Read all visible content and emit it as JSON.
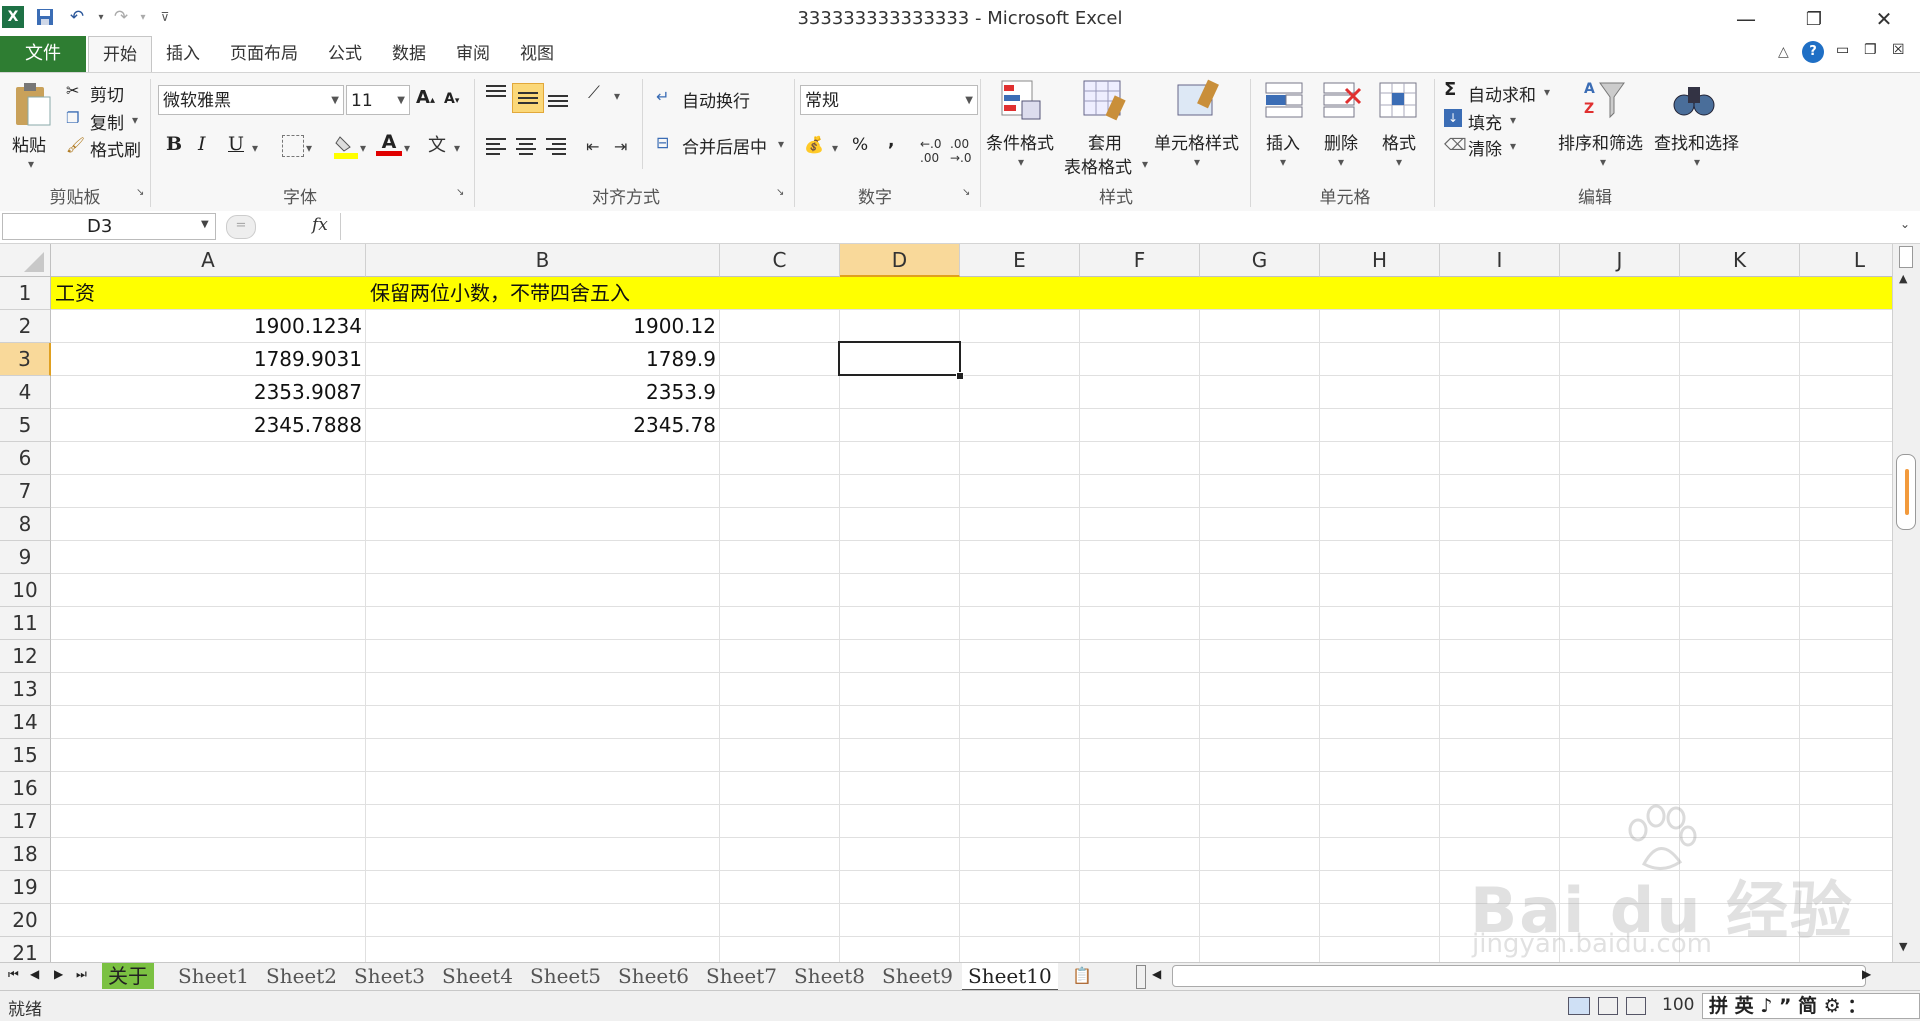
{
  "window": {
    "title": "333333333333333 - Microsoft Excel",
    "minimize_icon": "minimize-icon",
    "restore_icon": "restore-icon",
    "close_icon": "close-icon"
  },
  "tabs": [
    "文件",
    "开始",
    "插入",
    "页面布局",
    "公式",
    "数据",
    "审阅",
    "视图"
  ],
  "ribbon": {
    "clipboard": {
      "paste": "粘贴",
      "cut": "剪切",
      "copy": "复制",
      "format_painter": "格式刷",
      "label": "剪贴板"
    },
    "font": {
      "name": "微软雅黑",
      "size": "11",
      "label": "字体",
      "bold": "B",
      "italic": "I",
      "underline": "U"
    },
    "alignment": {
      "wrap": "自动换行",
      "merge": "合并后居中",
      "label": "对齐方式"
    },
    "number": {
      "format": "常规",
      "percent": "%",
      "comma": ",",
      "label": "数字"
    },
    "styles": {
      "conditional": "条件格式",
      "table_line1": "套用",
      "table_line2": "表格格式",
      "cell_styles": "单元格样式",
      "label": "样式"
    },
    "cells": {
      "insert": "插入",
      "delete": "删除",
      "format": "格式",
      "label": "单元格"
    },
    "editing": {
      "autosum": "自动求和",
      "fill": "填充",
      "clear": "清除",
      "sort": "排序和筛选",
      "find": "查找和选择",
      "label": "编辑"
    }
  },
  "formula_bar": {
    "name_box": "D3",
    "fx": "fx",
    "value": ""
  },
  "grid": {
    "columns": [
      "A",
      "B",
      "C",
      "D",
      "E",
      "F",
      "G",
      "H",
      "I",
      "J",
      "K",
      "L"
    ],
    "selected_column": "D",
    "selected_row": 3,
    "rows": [
      "1",
      "2",
      "3",
      "4",
      "5",
      "6",
      "7",
      "8",
      "9",
      "10",
      "11",
      "12",
      "13",
      "14",
      "15",
      "16",
      "17",
      "18",
      "19",
      "20",
      "21"
    ],
    "header_row": {
      "a": "工资",
      "b": "保留两位小数，不带四舍五入"
    },
    "data": [
      {
        "a": "1900.1234",
        "b": "1900.12"
      },
      {
        "a": "1789.9031",
        "b": "1789.9"
      },
      {
        "a": "2353.9087",
        "b": "2353.9"
      },
      {
        "a": "2345.7888",
        "b": "2345.78"
      }
    ],
    "highlight_color": "#ffff00"
  },
  "sheets": [
    "关于",
    "Sheet1",
    "Sheet2",
    "Sheet3",
    "Sheet4",
    "Sheet5",
    "Sheet6",
    "Sheet7",
    "Sheet8",
    "Sheet9",
    "Sheet10"
  ],
  "active_sheet": "Sheet10",
  "status": {
    "ready": "就绪",
    "zoom": "100",
    "ime": "拼 英 ♪ ” 简 ⚙ ："
  },
  "watermark": {
    "brand": "Bai du 经验",
    "url": "jingyan.baidu.com"
  }
}
